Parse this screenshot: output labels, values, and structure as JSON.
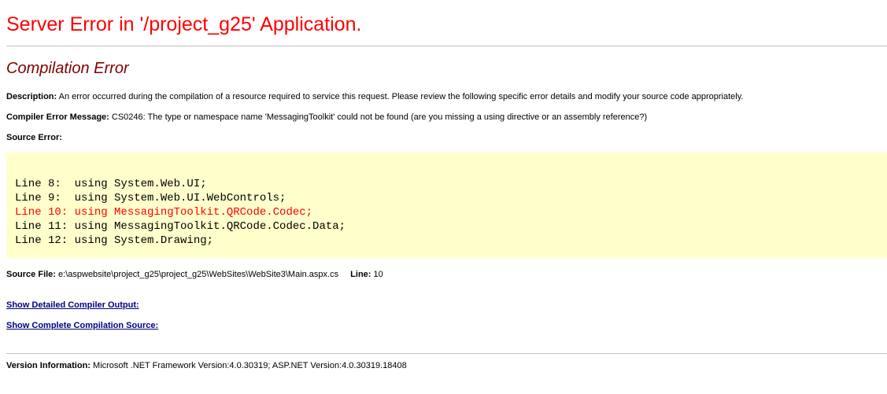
{
  "page": {
    "title": "Server Error in '/project_g25' Application.",
    "subtitle": "Compilation Error"
  },
  "description": {
    "label": "Description:",
    "text": "An error occurred during the compilation of a resource required to service this request. Please review the following specific error details and modify your source code appropriately."
  },
  "compiler_error": {
    "label": "Compiler Error Message:",
    "text": "CS0246: The type or namespace name 'MessagingToolkit' could not be found (are you missing a using directive or an assembly reference?)"
  },
  "source_error": {
    "label": "Source Error:",
    "lines": [
      {
        "text": "Line 8:  using System.Web.UI;",
        "error": false
      },
      {
        "text": "Line 9:  using System.Web.UI.WebControls;",
        "error": false
      },
      {
        "text": "Line 10: using MessagingToolkit.QRCode.Codec;",
        "error": true
      },
      {
        "text": "Line 11: using MessagingToolkit.QRCode.Codec.Data;",
        "error": false
      },
      {
        "text": "Line 12: using System.Drawing;",
        "error": false
      }
    ]
  },
  "source_file": {
    "label": "Source File:",
    "path": "e:\\aspwebsite\\project_g25\\project_g25\\WebSites\\WebSite3\\Main.aspx.cs",
    "line_label": "Line:",
    "line_value": "10"
  },
  "links": {
    "detailed_output": "Show Detailed Compiler Output:",
    "complete_source": "Show Complete Compilation Source:"
  },
  "version": {
    "label": "Version Information:",
    "text": "Microsoft .NET Framework Version:4.0.30319; ASP.NET Version:4.0.30319.18408"
  },
  "colors": {
    "title": "#ff0000",
    "subtitle": "#800000",
    "code_background": "#ffffcc",
    "error_line": "#ff0000",
    "link": "#000080"
  }
}
